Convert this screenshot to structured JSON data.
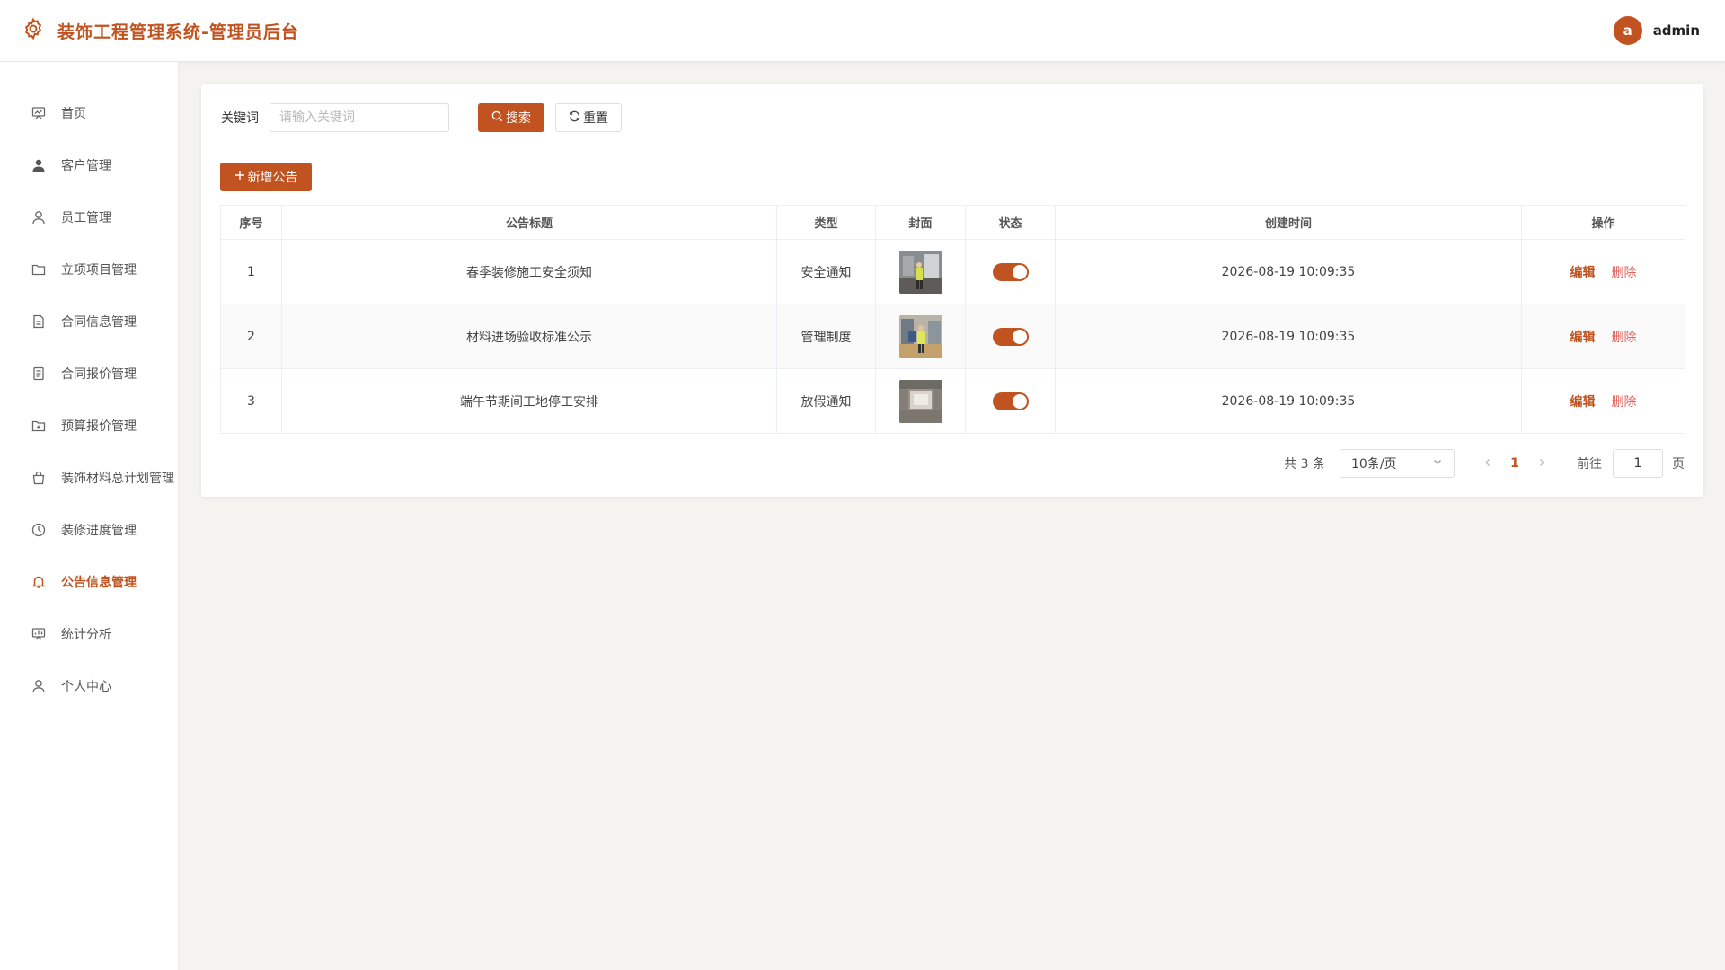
{
  "app": {
    "title": "装饰工程管理系统-管理员后台",
    "user_initial": "a",
    "username": "admin",
    "accent": "#c0531f"
  },
  "sidebar": {
    "items": [
      {
        "label": "首页",
        "icon": "dashboard-icon"
      },
      {
        "label": "客户管理",
        "icon": "user-filled-icon"
      },
      {
        "label": "员工管理",
        "icon": "user-icon"
      },
      {
        "label": "立项项目管理",
        "icon": "folder-icon"
      },
      {
        "label": "合同信息管理",
        "icon": "document-icon"
      },
      {
        "label": "合同报价管理",
        "icon": "document-list-icon"
      },
      {
        "label": "预算报价管理",
        "icon": "folder-add-icon"
      },
      {
        "label": "装饰材料总计划管理",
        "icon": "shopping-bag-icon"
      },
      {
        "label": "装修进度管理",
        "icon": "clock-icon"
      },
      {
        "label": "公告信息管理",
        "icon": "bell-icon",
        "active": true
      },
      {
        "label": "统计分析",
        "icon": "presentation-icon"
      },
      {
        "label": "个人中心",
        "icon": "user-icon"
      }
    ]
  },
  "search": {
    "label": "关键词",
    "placeholder": "请输入关键词",
    "value": "",
    "search_button": "搜索",
    "reset_button": "重置"
  },
  "add_button": "新增公告",
  "table": {
    "headers": [
      "序号",
      "公告标题",
      "类型",
      "封面",
      "状态",
      "创建时间",
      "操作"
    ],
    "rows": [
      {
        "index": "1",
        "title": "春季装修施工安全须知",
        "type": "安全通知",
        "enabled": true,
        "created": "2026-08-19 10:09:35"
      },
      {
        "index": "2",
        "title": "材料进场验收标准公示",
        "type": "管理制度",
        "enabled": true,
        "created": "2026-08-19 10:09:35"
      },
      {
        "index": "3",
        "title": "端午节期间工地停工安排",
        "type": "放假通知",
        "enabled": true,
        "created": "2026-08-19 10:09:35"
      }
    ],
    "edit_label": "编辑",
    "delete_label": "删除"
  },
  "pagination": {
    "total": "共 3 条",
    "page_size": "10条/页",
    "current_page": "1",
    "goto_label": "前往",
    "goto_value": "1",
    "page_unit": "页"
  }
}
